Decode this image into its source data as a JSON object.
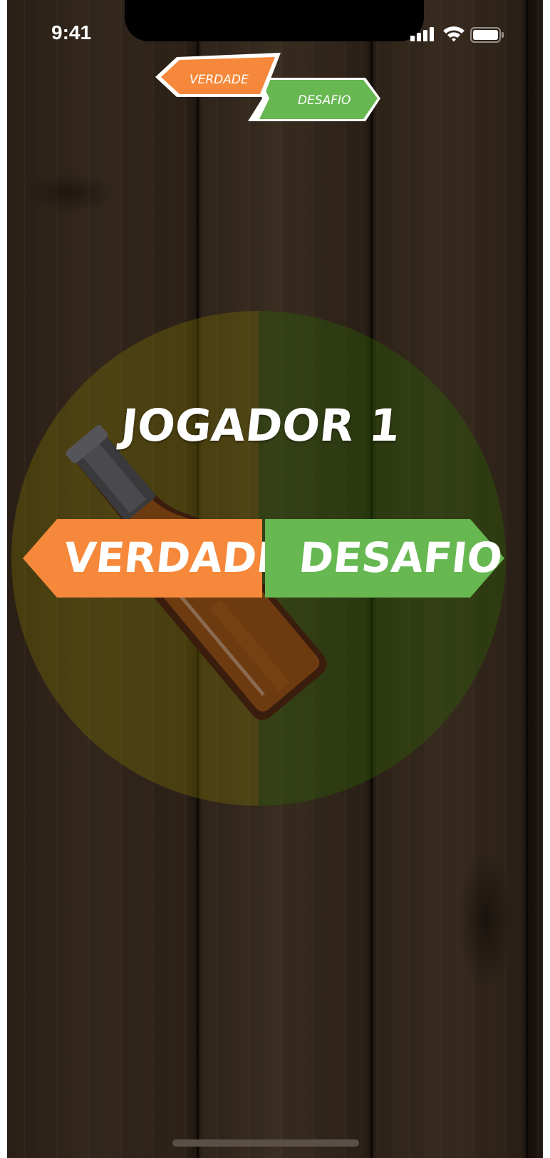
{
  "status_bar": {
    "time": "9:41"
  },
  "logo": {
    "truth": "VERDADE",
    "dare": "DESAFIO"
  },
  "player": {
    "name": "JOGADOR 1"
  },
  "choices": {
    "truth_label": "VERDADE",
    "dare_label": "DESAFIO"
  },
  "colors": {
    "truth": "#F5883A",
    "dare": "#67B851"
  }
}
